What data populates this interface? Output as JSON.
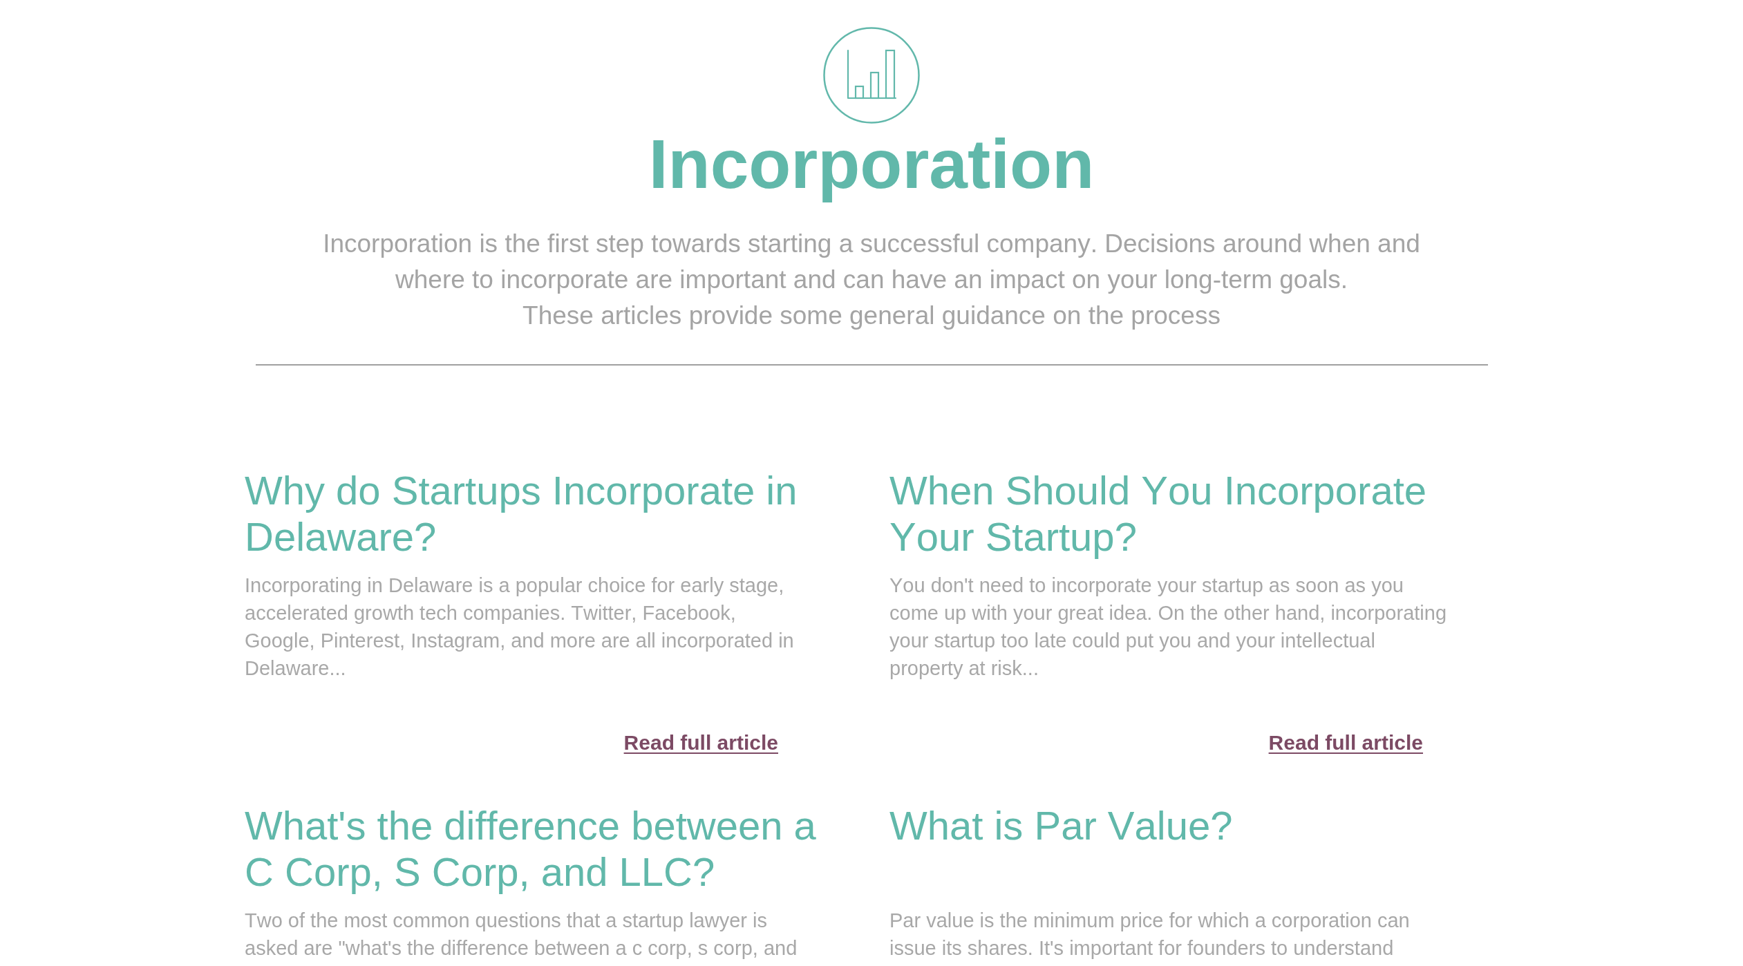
{
  "header": {
    "title": "Incorporation",
    "intro": "Incorporation is the first step towards starting a successful company. Decisions around when and where to incorporate are important and can have an impact on your long-term goals.\nThese articles provide some general guidance on the process"
  },
  "articles": [
    {
      "title": "Why do Startups Incorporate in Delaware?",
      "excerpt": "Incorporating in Delaware is a popular choice for early stage, accelerated growth tech companies. Twitter, Facebook, Google, Pinterest, Instagram, and more are all incorporated in Delaware...",
      "link": "Read full article"
    },
    {
      "title": "When Should You Incorporate Your Startup?",
      "excerpt": "You don't need to incorporate your startup as soon as you come up with your great idea. On the other hand, incorporating your startup too late could put you and your intellectual property at risk...",
      "link": "Read full article"
    },
    {
      "title": "What's the difference between a C Corp, S Corp, and LLC?",
      "excerpt": "Two of the most common questions that a startup lawyer is asked are \"what's the difference between a c corp, s corp, and"
    },
    {
      "title": "What is Par Value?",
      "excerpt": "Par value is the minimum price for which a corporation can issue its shares. It's important for founders to understand"
    }
  ]
}
